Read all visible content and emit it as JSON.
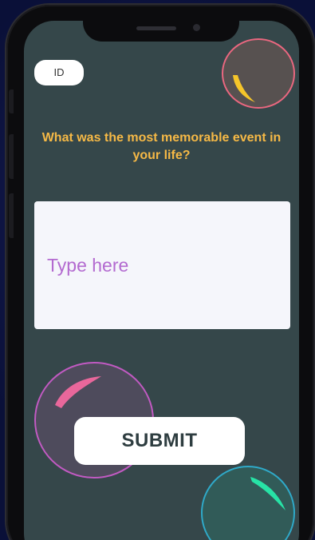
{
  "badge": {
    "label": "ID"
  },
  "question": {
    "text": "What was the most memorable event in your life?"
  },
  "answer": {
    "value": "",
    "placeholder": "Type here"
  },
  "submit": {
    "label": "SUBMIT"
  },
  "colors": {
    "screen_bg": "#35474a",
    "question_text": "#f6b946",
    "placeholder": "#b36ad0",
    "bubble_yellow_highlight": "#f5c52a",
    "bubble_pink_highlight": "#e9679b",
    "bubble_green_highlight": "#27e3a6"
  },
  "icons": [
    "bubble-yellow",
    "bubble-pink",
    "bubble-green"
  ]
}
